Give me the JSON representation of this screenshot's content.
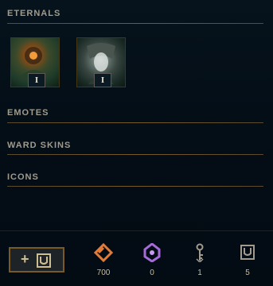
{
  "sections": {
    "eternals": "ETERNALS",
    "emotes": "EMOTES",
    "ward_skins": "WARD SKINS",
    "icons": "ICONS"
  },
  "eternals": [
    {
      "rank": "I"
    },
    {
      "rank": "I"
    }
  ],
  "currencies": [
    {
      "name": "orange-essence-icon",
      "value": "700",
      "color": "#e07b39"
    },
    {
      "name": "mythic-essence-icon",
      "value": "0",
      "color": "#a56bd8"
    },
    {
      "name": "key-icon",
      "value": "1",
      "color": "#a09b8c"
    },
    {
      "name": "loot-chest-icon",
      "value": "5",
      "color": "#a09b8c"
    }
  ]
}
